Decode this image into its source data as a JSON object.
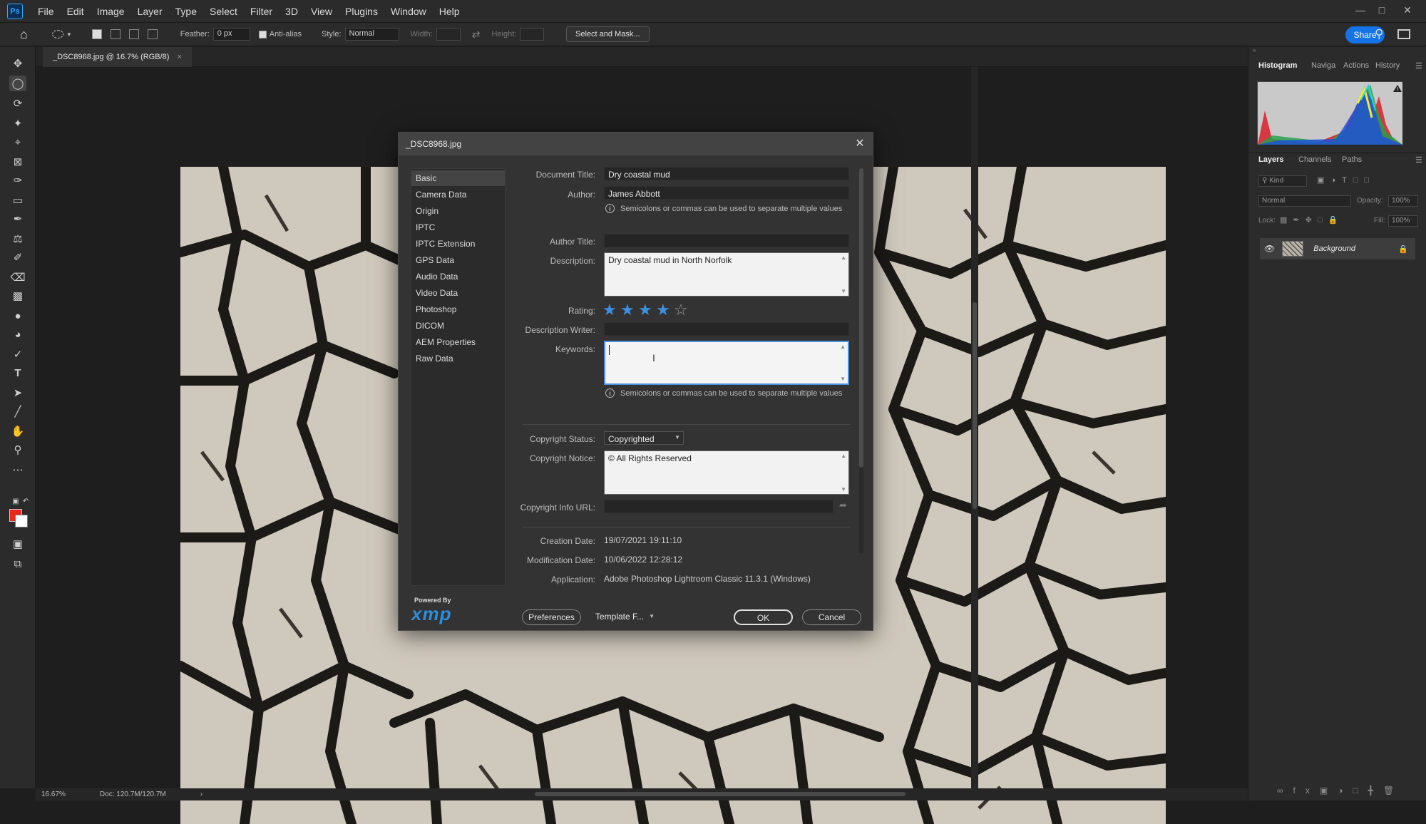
{
  "app": {
    "logo": "Ps"
  },
  "menu": [
    "File",
    "Edit",
    "Image",
    "Layer",
    "Type",
    "Select",
    "Filter",
    "3D",
    "View",
    "Plugins",
    "Window",
    "Help"
  ],
  "options": {
    "feather_label": "Feather:",
    "feather_value": "0 px",
    "antialias_label": "Anti-alias",
    "style_label": "Style:",
    "style_value": "Normal",
    "width_label": "Width:",
    "height_label": "Height:",
    "select_mask": "Select and Mask...",
    "share": "Share"
  },
  "document_tab": "_DSC8968.jpg @ 16.7% (RGB/8)",
  "status": {
    "zoom": "16.67%",
    "doc": "Doc: 120.7M/120.7M"
  },
  "panels": {
    "top_tabs": [
      "Histogram",
      "Naviga",
      "Actions",
      "History"
    ],
    "layer_tabs": [
      "Layers",
      "Channels",
      "Paths"
    ],
    "kind_label": "Kind",
    "blend_mode": "Normal",
    "opacity_label": "Opacity:",
    "opacity_value": "100%",
    "lock_label": "Lock:",
    "fill_label": "Fill:",
    "fill_value": "100%",
    "layer_name": "Background"
  },
  "dialog": {
    "title": "_DSC8968.jpg",
    "sidebar": [
      "Basic",
      "Camera Data",
      "Origin",
      "IPTC",
      "IPTC Extension",
      "GPS Data",
      "Audio Data",
      "Video Data",
      "Photoshop",
      "DICOM",
      "AEM Properties",
      "Raw Data"
    ],
    "selected_section": "Basic",
    "fields": {
      "document_title_label": "Document Title:",
      "document_title": "Dry coastal mud",
      "author_label": "Author:",
      "author": "James Abbott",
      "separator_hint": "Semicolons or commas can be used to separate multiple values",
      "author_title_label": "Author Title:",
      "author_title": "",
      "description_label": "Description:",
      "description": "Dry coastal mud in North Norfolk",
      "rating_label": "Rating:",
      "rating": 4,
      "rating_max": 5,
      "description_writer_label": "Description Writer:",
      "description_writer": "",
      "keywords_label": "Keywords:",
      "keywords": "",
      "keywords_hint": "Semicolons or commas can be used to separate multiple values",
      "copyright_status_label": "Copyright Status:",
      "copyright_status": "Copyrighted",
      "copyright_notice_label": "Copyright Notice:",
      "copyright_notice": "© All Rights Reserved",
      "copyright_url_label": "Copyright Info URL:",
      "copyright_url": "",
      "creation_date_label": "Creation Date:",
      "creation_date": "19/07/2021 19:11:10",
      "modification_date_label": "Modification Date:",
      "modification_date": "10/06/2022 12:28:12",
      "application_label": "Application:",
      "application": "Adobe Photoshop Lightroom Classic 11.3.1 (Windows)"
    },
    "powered_by": "Powered By",
    "xmp_logo": "xmp",
    "buttons": {
      "preferences": "Preferences",
      "template": "Template F...",
      "ok": "OK",
      "cancel": "Cancel"
    }
  },
  "colors": {
    "accent": "#1473e6",
    "star": "#3d8fe0",
    "foreground": "#e8271d",
    "background": "#ffffff"
  }
}
